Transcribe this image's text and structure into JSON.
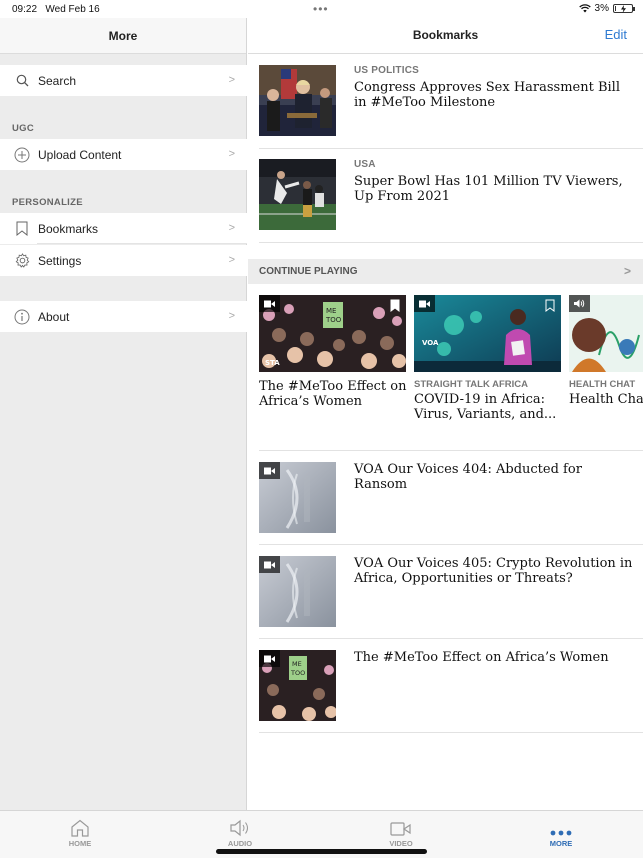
{
  "status": {
    "time": "09:22",
    "date": "Wed Feb 16",
    "battery": "3%",
    "battery_level": 0.03
  },
  "sidebar": {
    "title": "More",
    "search": {
      "label": "Search",
      "icon": "search-icon"
    },
    "sections": [
      {
        "header": "UGC",
        "items": [
          {
            "label": "Upload Content",
            "icon": "plus-circle-icon"
          }
        ]
      },
      {
        "header": "PERSONALIZE",
        "items": [
          {
            "label": "Bookmarks",
            "icon": "bookmark-icon"
          },
          {
            "label": "Settings",
            "icon": "gear-icon"
          }
        ]
      }
    ],
    "about": {
      "label": "About",
      "icon": "info-icon"
    }
  },
  "main": {
    "title": "Bookmarks",
    "edit_label": "Edit",
    "bookmarks": [
      {
        "kicker": "US POLITICS",
        "title": "Congress Approves Sex Harassment Bill in #MeToo Milestone"
      },
      {
        "kicker": "USA",
        "title": "Super Bowl Has 101 Million TV Viewers, Up From 2021"
      }
    ],
    "continue_playing": {
      "header": "CONTINUE PLAYING",
      "cards": [
        {
          "kicker": "",
          "title": "The #MeToo Effect on Africa’s Women",
          "media": "video-icon",
          "thumb_text": "STA"
        },
        {
          "kicker": "STRAIGHT TALK AFRICA",
          "title": "COVID-19 in Africa: Virus, Variants, and...",
          "media": "video-icon",
          "thumb_text": "VOA"
        },
        {
          "kicker": "HEALTH CHAT",
          "title": "Health Chat",
          "media": "speaker-icon",
          "thumb_text": ""
        }
      ]
    },
    "videos": [
      {
        "title": "VOA Our Voices 404: Abducted for Ransom"
      },
      {
        "title": "VOA Our Voices 405: Crypto Revolution in Africa, Opportunities or Threats?"
      },
      {
        "title": "The #MeToo Effect on Africa’s Women"
      }
    ]
  },
  "tabbar": {
    "tabs": [
      {
        "label": "HOME",
        "icon": "home-icon"
      },
      {
        "label": "AUDIO",
        "icon": "speaker-icon"
      },
      {
        "label": "VIDEO",
        "icon": "video-camera-icon"
      },
      {
        "label": "MORE",
        "icon": "more-dots-icon"
      }
    ],
    "active_color": "#2f6db5",
    "inactive_color": "#999999"
  },
  "colors": {
    "accent": "#2f7bd1",
    "background_grey": "#ececec"
  }
}
